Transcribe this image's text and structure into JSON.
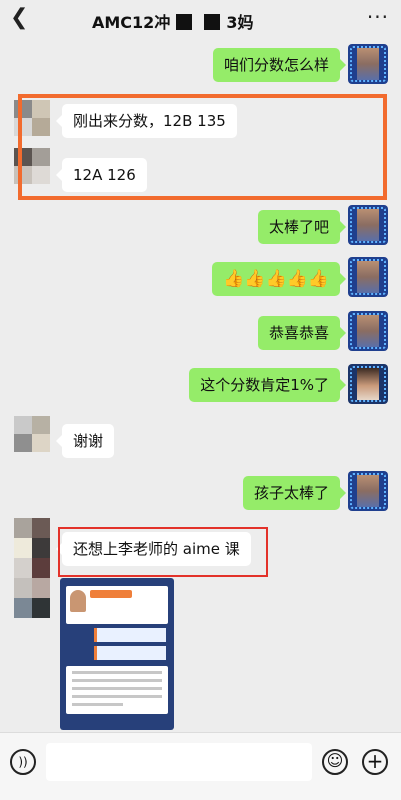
{
  "header": {
    "back_icon": "chevron-left-icon",
    "title_start": "AMC12冲",
    "title_end": "3妈",
    "more_icon": "more-dots-icon"
  },
  "messages": [
    {
      "side": "right",
      "text": "咱们分数怎么样"
    },
    {
      "side": "left",
      "text": "刚出来分数，12B 135"
    },
    {
      "side": "left",
      "text": "12A 126"
    },
    {
      "side": "right",
      "text": "太棒了吧"
    },
    {
      "side": "right",
      "text": "👍👍👍👍👍"
    },
    {
      "side": "right",
      "text": "恭喜恭喜"
    },
    {
      "side": "right",
      "text": "这个分数肯定1%了"
    },
    {
      "side": "left",
      "text": "谢谢"
    },
    {
      "side": "right",
      "text": "孩子太棒了"
    },
    {
      "side": "left",
      "text": "还想上李老师的 aime 课"
    },
    {
      "side": "left",
      "type": "image",
      "description": "course-poster"
    }
  ],
  "colors": {
    "background": "#ededed",
    "bubble_sent": "#95ec69",
    "bubble_received": "#ffffff",
    "highlight_orange": "#f26b2e",
    "highlight_red": "#e3322a"
  },
  "bottom_bar": {
    "voice_icon": "voice-icon",
    "emoji_icon": "emoji-icon",
    "plus_icon": "plus-icon"
  }
}
